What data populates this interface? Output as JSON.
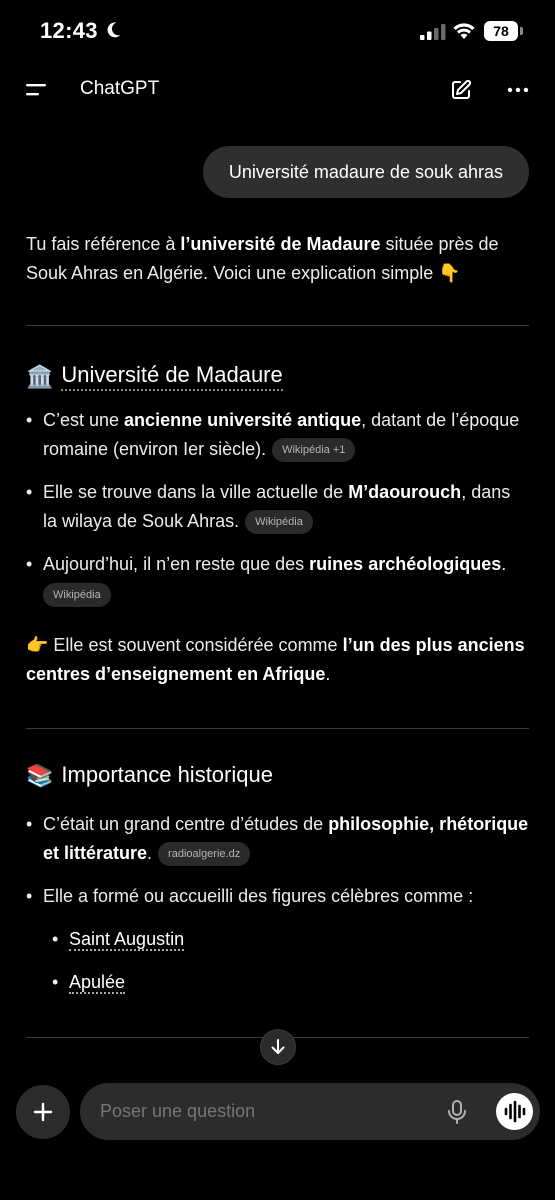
{
  "status_bar": {
    "time": "12:43",
    "battery": "78"
  },
  "header": {
    "title": "ChatGPT"
  },
  "user_message": "Université madaure de souk ahras",
  "intro": {
    "t1": "Tu fais référence à ",
    "b1": "l’université de Madaure",
    "t2": " située près de Souk Ahras en Algérie. Voici une explication simple ",
    "emoji": "👇"
  },
  "section1": {
    "emoji": "🏛️",
    "title": "Université de Madaure",
    "items": [
      {
        "t1": "C’est une ",
        "b": "ancienne université antique",
        "t2": ", datant de l’époque romaine (environ Ier siècle).",
        "chip": "Wikipédia +1"
      },
      {
        "t1": "Elle se trouve dans la ville actuelle de ",
        "b": "M’daourouch",
        "t2": ", dans la wilaya de Souk Ahras.",
        "chip": "Wikipédia"
      },
      {
        "t1": "Aujourd’hui, il n’en reste que des ",
        "b": "ruines archéologiques",
        "t2": ".",
        "chip": "Wikipédia"
      }
    ],
    "note": {
      "emoji": "👉",
      "t1": " Elle est souvent considérée comme ",
      "b": "l’un des plus anciens centres d’enseignement en Afrique",
      "t2": "."
    }
  },
  "section2": {
    "emoji": "📚",
    "title": "Importance historique",
    "items": [
      {
        "t1": "C’était un grand centre d’études de ",
        "b": "philosophie, rhétorique et littérature",
        "t2": ".",
        "chip": "radioalgerie.dz"
      },
      {
        "t1": "Elle a formé ou accueilli des figures célèbres comme :"
      }
    ],
    "sub_items": [
      "Saint Augustin",
      "Apulée"
    ]
  },
  "composer": {
    "placeholder": "Poser une question"
  },
  "icons": {
    "moon": "moon-icon",
    "signal": "cellular-signal-icon",
    "wifi": "wifi-icon",
    "battery": "battery-icon",
    "menu": "menu-icon",
    "new_chat": "new-chat-icon",
    "more": "more-options-icon",
    "scroll_down": "arrow-down-icon",
    "plus": "plus-icon",
    "mic": "microphone-icon",
    "voice": "voice-mode-icon"
  },
  "colors": {
    "background": "#000000",
    "bubble": "#2f2f2f",
    "composer": "#2c2c2c",
    "chip": "#2a2a2a"
  }
}
